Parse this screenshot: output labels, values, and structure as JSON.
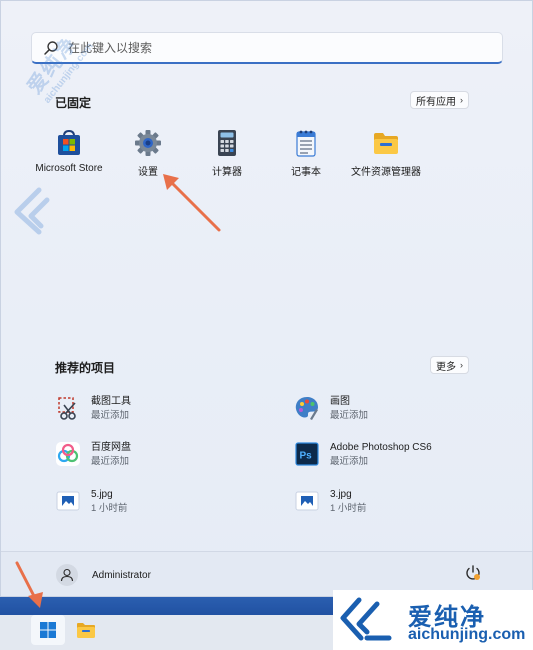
{
  "search": {
    "placeholder": "在此键入以搜索"
  },
  "pinned": {
    "title": "已固定",
    "all_apps_label": "所有应用",
    "apps": [
      {
        "label": "Microsoft Store",
        "icon": "microsoft-store-icon"
      },
      {
        "label": "设置",
        "icon": "settings-gear-icon"
      },
      {
        "label": "计算器",
        "icon": "calculator-icon"
      },
      {
        "label": "记事本",
        "icon": "notepad-icon"
      },
      {
        "label": "文件资源管理器",
        "icon": "file-explorer-icon"
      }
    ]
  },
  "recommended": {
    "title": "推荐的项目",
    "more_label": "更多",
    "items": [
      {
        "name": "截图工具",
        "sub": "最近添加",
        "icon": "snipping-tool-icon"
      },
      {
        "name": "画图",
        "sub": "最近添加",
        "icon": "paint-icon"
      },
      {
        "name": "百度网盘",
        "sub": "最近添加",
        "icon": "baidu-netdisk-icon"
      },
      {
        "name": "Adobe Photoshop CS6",
        "sub": "最近添加",
        "icon": "photoshop-icon"
      },
      {
        "name": "5.jpg",
        "sub": "1 小时前",
        "icon": "image-file-icon"
      },
      {
        "name": "3.jpg",
        "sub": "1 小时前",
        "icon": "image-file-icon"
      }
    ]
  },
  "footer": {
    "username": "Administrator"
  },
  "watermark": {
    "brand": "爱纯净",
    "url": "aichunjing.com",
    "diag_brand": "爱纯净",
    "diag_url": "aichunjing.com"
  },
  "colors": {
    "accent": "#3a6fc4",
    "arrow": "#e8704a",
    "watermark": "#1a5fb0"
  }
}
